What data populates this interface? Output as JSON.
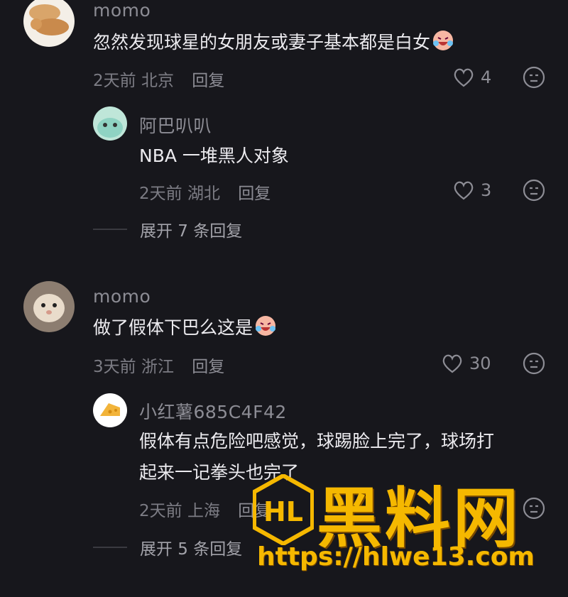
{
  "comments": [
    {
      "username": "momo",
      "text": "忽然发现球星的女朋友或妻子基本都是白女",
      "time": "2天前",
      "location": "北京",
      "reply_label": "回复",
      "likes": "4",
      "avatar_icon": "cats-avatar-icon"
    },
    {
      "username": "阿巴叭叭",
      "text": "NBA 一堆黑人对象",
      "time": "2天前",
      "location": "湖北",
      "reply_label": "回复",
      "likes": "3",
      "avatar_icon": "cartoon-avatar-icon"
    },
    {
      "username": "momo",
      "text": "做了假体下巴么这是",
      "time": "3天前",
      "location": "浙江",
      "reply_label": "回复",
      "likes": "30",
      "avatar_icon": "hamster-avatar-icon"
    },
    {
      "username": "小红薯685C4F42",
      "text_line1": "假体有点危险吧感觉，球踢脸上完了，球场打",
      "text_line2": "起来一记拳头也完了",
      "time": "2天前",
      "location": "上海",
      "reply_label": "回复",
      "avatar_icon": "cheese-avatar-icon"
    }
  ],
  "expand": [
    {
      "label": "展开 7 条回复"
    },
    {
      "label": "展开 5 条回复"
    }
  ],
  "watermark": {
    "title": "黑料网",
    "url": "https://hlwe13.com",
    "logo_text": "HL"
  },
  "colors": {
    "background": "#17171c",
    "watermark": "#f5b800"
  }
}
